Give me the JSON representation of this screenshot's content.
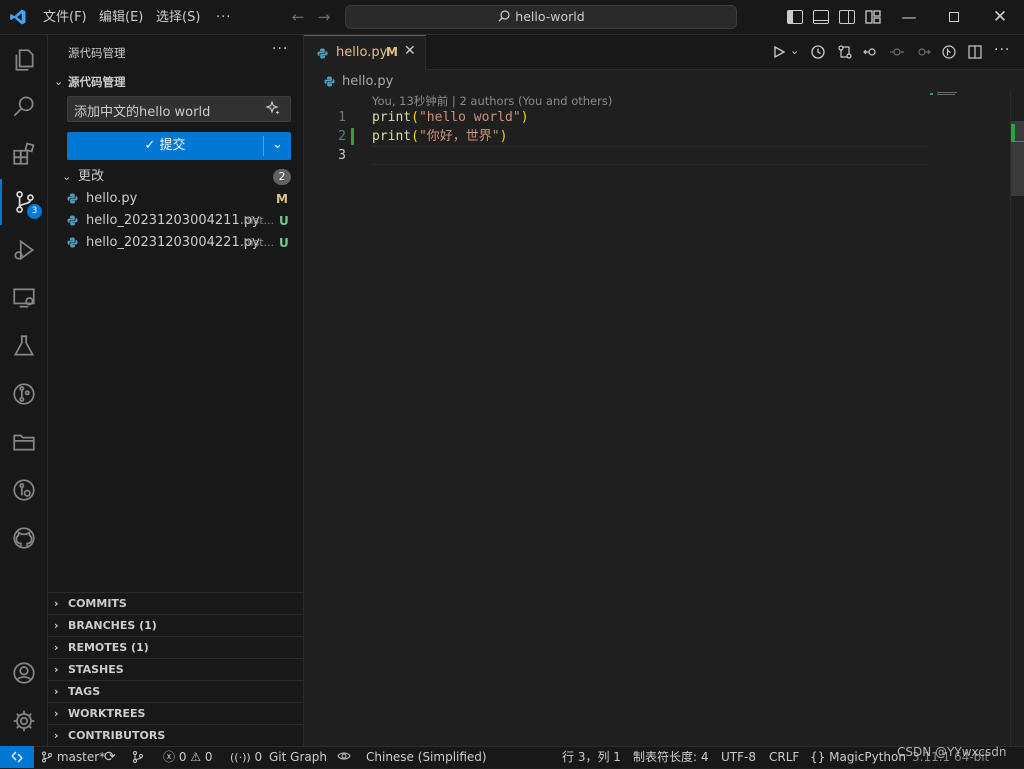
{
  "titlebar": {
    "menu": [
      "文件(F)",
      "编辑(E)",
      "选择(S)"
    ],
    "more": "···",
    "search_text": "hello-world"
  },
  "sidebar": {
    "title": "源代码管理",
    "more": "···",
    "section_title": "源代码管理",
    "commit_message": "添加中文的hello world",
    "commit_button": "✓ 提交",
    "changes_label": "更改",
    "changes_count": "2",
    "scm_badge": "3",
    "files": [
      {
        "name": "hello.py",
        "path": "",
        "status": "M"
      },
      {
        "name": "hello_20231203004211.py",
        "path": ".hist...",
        "status": "U"
      },
      {
        "name": "hello_20231203004221.py",
        "path": ".hist...",
        "status": "U"
      }
    ],
    "panels": [
      "COMMITS",
      "BRANCHES (1)",
      "REMOTES (1)",
      "STASHES",
      "TAGS",
      "WORKTREES",
      "CONTRIBUTORS"
    ]
  },
  "editor": {
    "tab_label": "hello.py",
    "tab_status": "M",
    "breadcrumb": "hello.py",
    "blame": "You, 13秒钟前 | 2 authors (You and others)",
    "lines": [
      {
        "num": "1",
        "fn": "print",
        "open": "(",
        "str": "\"hello world\"",
        "close": ")"
      },
      {
        "num": "2",
        "fn": "print",
        "open": "(",
        "str": "\"你好，世界\"",
        "close": ")"
      },
      {
        "num": "3",
        "fn": "",
        "open": "",
        "str": "",
        "close": ""
      }
    ]
  },
  "statusbar": {
    "branch": "master*",
    "errors": "0",
    "warnings": "0",
    "ports": "0",
    "git_graph": "Git Graph",
    "language_pack": "Chinese (Simplified)",
    "position": "行 3，列 1",
    "tab_size": "制表符长度: 4",
    "encoding": "UTF-8",
    "eol": "CRLF",
    "language": "MagicPython",
    "interpreter": "3.11.1 64-bit",
    "watermark": "CSDN @YYwxcsdn"
  },
  "colors": {
    "accent": "#0078d4",
    "modified": "#e2c08d",
    "untracked": "#73c991",
    "string": "#ce9178",
    "function": "#dcdcaa",
    "bracket": "#ffd700"
  }
}
